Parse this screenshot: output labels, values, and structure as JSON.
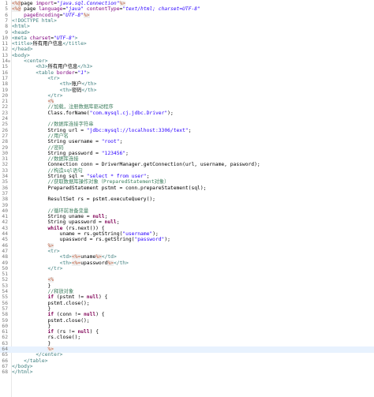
{
  "editor": {
    "caret_line": 64,
    "lines": [
      {
        "n": "1",
        "fold": "",
        "tokens": [
          [
            "jsp",
            "<%@"
          ],
          [
            "plain",
            "page "
          ],
          [
            "attr",
            "import"
          ],
          [
            "plain",
            "="
          ],
          [
            "val",
            "\"java.sql.Connection\""
          ],
          [
            "jsp",
            "%>"
          ]
        ]
      },
      {
        "n": "5",
        "fold": "",
        "tokens": [
          [
            "jsp",
            "<%@"
          ],
          [
            "plain",
            " page "
          ],
          [
            "attr",
            "language"
          ],
          [
            "plain",
            "="
          ],
          [
            "val",
            "\"java\""
          ],
          [
            "plain",
            " "
          ],
          [
            "attr",
            "contentType"
          ],
          [
            "plain",
            "="
          ],
          [
            "val",
            "\"text/html; charset=UTF-8\""
          ]
        ]
      },
      {
        "n": "6",
        "fold": "",
        "tokens": [
          [
            "plain",
            "    "
          ],
          [
            "attr",
            "pageEncoding"
          ],
          [
            "plain",
            "="
          ],
          [
            "val",
            "\"UTF-8\""
          ],
          [
            "jsp",
            "%>"
          ]
        ]
      },
      {
        "n": "7",
        "fold": "",
        "tokens": [
          [
            "tag",
            "<!DOCTYPE html>"
          ]
        ]
      },
      {
        "n": "8",
        "fold": "",
        "tokens": [
          [
            "tag",
            "<html>"
          ]
        ]
      },
      {
        "n": "9",
        "fold": "",
        "tokens": [
          [
            "tag",
            "<head>"
          ]
        ]
      },
      {
        "n": "10",
        "fold": "",
        "tokens": [
          [
            "tag",
            "<meta "
          ],
          [
            "attr",
            "charset"
          ],
          [
            "plain",
            "="
          ],
          [
            "val",
            "\"UTF-8\""
          ],
          [
            "tag",
            ">"
          ]
        ]
      },
      {
        "n": "11",
        "fold": "",
        "tokens": [
          [
            "tag",
            "<title>"
          ],
          [
            "plain",
            "所有用户信息"
          ],
          [
            "tag",
            "</title>"
          ]
        ]
      },
      {
        "n": "12",
        "fold": "",
        "tokens": [
          [
            "tag",
            "</head>"
          ]
        ]
      },
      {
        "n": "13",
        "fold": "",
        "tokens": [
          [
            "tag",
            "<body>"
          ]
        ]
      },
      {
        "n": "14",
        "fold": "⊖",
        "tokens": [
          [
            "plain",
            "    "
          ],
          [
            "tag",
            "<center>"
          ]
        ]
      },
      {
        "n": "15",
        "fold": "",
        "tokens": [
          [
            "plain",
            "        "
          ],
          [
            "tag",
            "<h3>"
          ],
          [
            "plain",
            "所有用户信息"
          ],
          [
            "tag",
            "</h3>"
          ]
        ]
      },
      {
        "n": "16",
        "fold": "",
        "tokens": [
          [
            "plain",
            "        "
          ],
          [
            "tag",
            "<table "
          ],
          [
            "attr",
            "border"
          ],
          [
            "plain",
            "="
          ],
          [
            "val",
            "\"1\""
          ],
          [
            "tag",
            ">"
          ]
        ]
      },
      {
        "n": "17",
        "fold": "",
        "tokens": [
          [
            "plain",
            "            "
          ],
          [
            "tag",
            "<tr>"
          ]
        ]
      },
      {
        "n": "18",
        "fold": "",
        "tokens": [
          [
            "plain",
            "                "
          ],
          [
            "tag",
            "<th>"
          ],
          [
            "plain",
            "账户"
          ],
          [
            "tag",
            "</th>"
          ]
        ]
      },
      {
        "n": "19",
        "fold": "",
        "tokens": [
          [
            "plain",
            "                "
          ],
          [
            "tag",
            "<th>"
          ],
          [
            "plain",
            "密码"
          ],
          [
            "tag",
            "</th>"
          ]
        ]
      },
      {
        "n": "20",
        "fold": "",
        "tokens": [
          [
            "plain",
            "            "
          ],
          [
            "tag",
            "</tr>"
          ]
        ]
      },
      {
        "n": "21",
        "fold": "",
        "tokens": [
          [
            "plain",
            "            "
          ],
          [
            "jsp",
            "<%"
          ]
        ]
      },
      {
        "n": "22",
        "fold": "",
        "tokens": [
          [
            "plain",
            "            "
          ],
          [
            "cmt",
            "//加载，注册数据库驱动程序"
          ]
        ]
      },
      {
        "n": "23",
        "fold": "",
        "tokens": [
          [
            "plain",
            "            Class.forName("
          ],
          [
            "str",
            "\"com.mysql.cj.jdbc.Driver\""
          ],
          [
            "plain",
            ");"
          ]
        ]
      },
      {
        "n": "24",
        "fold": "",
        "tokens": []
      },
      {
        "n": "25",
        "fold": "",
        "tokens": [
          [
            "plain",
            "            "
          ],
          [
            "cmt",
            "//数据库连接字符串"
          ]
        ]
      },
      {
        "n": "26",
        "fold": "",
        "tokens": [
          [
            "plain",
            "            String url = "
          ],
          [
            "str",
            "\"jdbc:mysql://localhost:3306/text\""
          ],
          [
            "plain",
            ";"
          ]
        ]
      },
      {
        "n": "27",
        "fold": "",
        "tokens": [
          [
            "plain",
            "            "
          ],
          [
            "cmt",
            "//用户名"
          ]
        ]
      },
      {
        "n": "28",
        "fold": "",
        "tokens": [
          [
            "plain",
            "            String username = "
          ],
          [
            "str",
            "\"root\""
          ],
          [
            "plain",
            ";"
          ]
        ]
      },
      {
        "n": "29",
        "fold": "",
        "tokens": [
          [
            "plain",
            "            "
          ],
          [
            "cmt",
            "//密码"
          ]
        ]
      },
      {
        "n": "30",
        "fold": "",
        "tokens": [
          [
            "plain",
            "            String password = "
          ],
          [
            "str",
            "\"123456\""
          ],
          [
            "plain",
            ";"
          ]
        ]
      },
      {
        "n": "31",
        "fold": "",
        "tokens": [
          [
            "plain",
            "            "
          ],
          [
            "cmt",
            "//数据库连接"
          ]
        ]
      },
      {
        "n": "32",
        "fold": "",
        "tokens": [
          [
            "plain",
            "            Connection conn = DriverManager.getConnection(url, username, password);"
          ]
        ]
      },
      {
        "n": "33",
        "fold": "",
        "tokens": [
          [
            "plain",
            "            "
          ],
          [
            "cmt",
            "//构造sql语句"
          ]
        ]
      },
      {
        "n": "34",
        "fold": "",
        "tokens": [
          [
            "plain",
            "            String sql = "
          ],
          [
            "str",
            "\"select * from user\""
          ],
          [
            "plain",
            ";"
          ]
        ]
      },
      {
        "n": "35",
        "fold": "",
        "tokens": [
          [
            "plain",
            "            "
          ],
          [
            "cmt",
            "//获取数据库操作对象（PreparedStatement对象）"
          ]
        ]
      },
      {
        "n": "36",
        "fold": "",
        "tokens": [
          [
            "plain",
            "            PreparedStatement pstmt = conn.prepareStatement(sql);"
          ]
        ]
      },
      {
        "n": "37",
        "fold": "",
        "tokens": []
      },
      {
        "n": "38",
        "fold": "",
        "tokens": [
          [
            "plain",
            "            ResultSet rs = pstmt.executeQuery();"
          ]
        ]
      },
      {
        "n": "39",
        "fold": "",
        "tokens": []
      },
      {
        "n": "40",
        "fold": "",
        "tokens": [
          [
            "plain",
            "            "
          ],
          [
            "cmt",
            "//循环前准备变量"
          ]
        ]
      },
      {
        "n": "41",
        "fold": "",
        "tokens": [
          [
            "plain",
            "            String uname = "
          ],
          [
            "kw",
            "null"
          ],
          [
            "plain",
            ";"
          ]
        ]
      },
      {
        "n": "42",
        "fold": "",
        "tokens": [
          [
            "plain",
            "            String upassword = "
          ],
          [
            "kw",
            "null"
          ],
          [
            "plain",
            ";"
          ]
        ]
      },
      {
        "n": "43",
        "fold": "",
        "tokens": [
          [
            "plain",
            "            "
          ],
          [
            "kw",
            "while"
          ],
          [
            "plain",
            " (rs.next()) {"
          ]
        ]
      },
      {
        "n": "44",
        "fold": "",
        "tokens": [
          [
            "plain",
            "                uname = rs.getString("
          ],
          [
            "str",
            "\"username\""
          ],
          [
            "plain",
            ");"
          ]
        ]
      },
      {
        "n": "45",
        "fold": "",
        "tokens": [
          [
            "plain",
            "                upassword = rs.getString("
          ],
          [
            "str",
            "\"password\""
          ],
          [
            "plain",
            ");"
          ]
        ]
      },
      {
        "n": "46",
        "fold": "",
        "tokens": [
          [
            "plain",
            "            "
          ],
          [
            "jsp",
            "%>"
          ]
        ]
      },
      {
        "n": "47",
        "fold": "",
        "tokens": [
          [
            "plain",
            "            "
          ],
          [
            "tag",
            "<tr>"
          ]
        ]
      },
      {
        "n": "48",
        "fold": "",
        "tokens": [
          [
            "plain",
            "                "
          ],
          [
            "tag",
            "<td>"
          ],
          [
            "jsp",
            "<%="
          ],
          [
            "plain",
            "uname"
          ],
          [
            "jsp",
            "%>"
          ],
          [
            "tag",
            "</td>"
          ]
        ]
      },
      {
        "n": "49",
        "fold": "",
        "tokens": [
          [
            "plain",
            "                "
          ],
          [
            "tag",
            "<th>"
          ],
          [
            "jsp",
            "<%="
          ],
          [
            "plain",
            "upassword"
          ],
          [
            "jsp",
            "%>"
          ],
          [
            "tag",
            "</th>"
          ]
        ]
      },
      {
        "n": "50",
        "fold": "",
        "tokens": [
          [
            "plain",
            "            "
          ],
          [
            "tag",
            "</tr>"
          ]
        ]
      },
      {
        "n": "51",
        "fold": "",
        "tokens": []
      },
      {
        "n": "52",
        "fold": "",
        "tokens": [
          [
            "plain",
            "            "
          ],
          [
            "jsp",
            "<%"
          ]
        ]
      },
      {
        "n": "53",
        "fold": "",
        "tokens": [
          [
            "plain",
            "            }"
          ]
        ]
      },
      {
        "n": "54",
        "fold": "",
        "tokens": [
          [
            "plain",
            "            "
          ],
          [
            "cmt",
            "//释放对象"
          ]
        ]
      },
      {
        "n": "55",
        "fold": "",
        "tokens": [
          [
            "plain",
            "            "
          ],
          [
            "kw",
            "if"
          ],
          [
            "plain",
            " (pstmt != "
          ],
          [
            "kw",
            "null"
          ],
          [
            "plain",
            ") {"
          ]
        ]
      },
      {
        "n": "56",
        "fold": "",
        "tokens": [
          [
            "plain",
            "            pstmt.close();"
          ]
        ]
      },
      {
        "n": "57",
        "fold": "",
        "tokens": [
          [
            "plain",
            "            }"
          ]
        ]
      },
      {
        "n": "58",
        "fold": "",
        "tokens": [
          [
            "plain",
            "            "
          ],
          [
            "kw",
            "if"
          ],
          [
            "plain",
            " (conn != "
          ],
          [
            "kw",
            "null"
          ],
          [
            "plain",
            ") {"
          ]
        ]
      },
      {
        "n": "59",
        "fold": "",
        "tokens": [
          [
            "plain",
            "            pstmt.close();"
          ]
        ]
      },
      {
        "n": "60",
        "fold": "",
        "tokens": [
          [
            "plain",
            "            }"
          ]
        ]
      },
      {
        "n": "61",
        "fold": "",
        "tokens": [
          [
            "plain",
            "            "
          ],
          [
            "kw",
            "if"
          ],
          [
            "plain",
            " (rs != "
          ],
          [
            "kw",
            "null"
          ],
          [
            "plain",
            ") {"
          ]
        ]
      },
      {
        "n": "62",
        "fold": "",
        "tokens": [
          [
            "plain",
            "            rs.close();"
          ]
        ]
      },
      {
        "n": "63",
        "fold": "",
        "tokens": [
          [
            "plain",
            "            }"
          ]
        ]
      },
      {
        "n": "64",
        "fold": "",
        "tokens": [
          [
            "plain",
            "            "
          ],
          [
            "jsp",
            "%>"
          ]
        ]
      },
      {
        "n": "65",
        "fold": "",
        "tokens": [
          [
            "plain",
            "        "
          ],
          [
            "tag",
            "</center>"
          ]
        ]
      },
      {
        "n": "66",
        "fold": "",
        "tokens": [
          [
            "plain",
            "    "
          ],
          [
            "tag",
            "</table>"
          ]
        ]
      },
      {
        "n": "67",
        "fold": "",
        "tokens": [
          [
            "tag",
            "</body>"
          ]
        ]
      },
      {
        "n": "68",
        "fold": "",
        "tokens": [
          [
            "tag",
            "</html>"
          ]
        ]
      }
    ]
  }
}
